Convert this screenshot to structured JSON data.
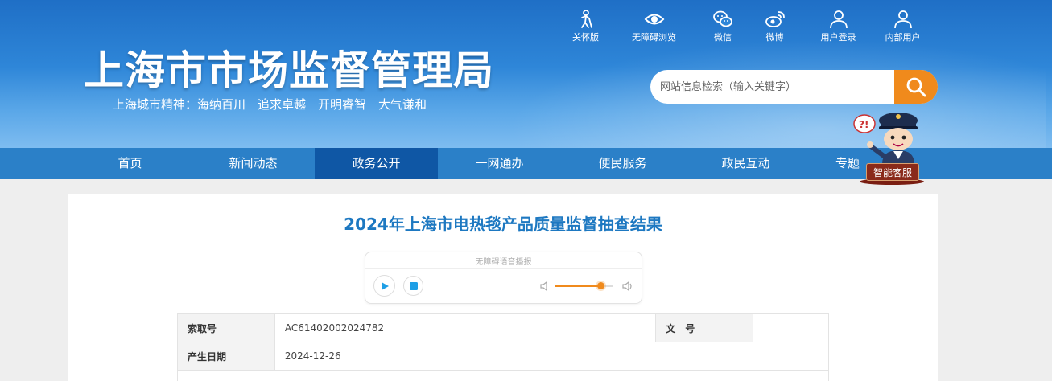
{
  "header": {
    "site_title": "上海市市场监督管理局",
    "city_spirit": "上海城市精神：海纳百川　追求卓越　开明睿智　大气谦和"
  },
  "toolbar": {
    "items": [
      {
        "label": "关怀版",
        "icon": "elder-care-icon"
      },
      {
        "label": "无障碍浏览",
        "icon": "eye-icon"
      },
      {
        "label": "微信",
        "icon": "wechat-icon"
      },
      {
        "label": "微博",
        "icon": "weibo-icon"
      },
      {
        "label": "用户登录",
        "icon": "user-icon"
      },
      {
        "label": "内部用户",
        "icon": "user-icon"
      }
    ]
  },
  "search": {
    "placeholder": "网站信息检索（输入关键字）"
  },
  "nav": {
    "items": [
      {
        "label": "首页"
      },
      {
        "label": "新闻动态"
      },
      {
        "label": "政务公开",
        "active": true
      },
      {
        "label": "一网通办"
      },
      {
        "label": "便民服务"
      },
      {
        "label": "政民互动"
      },
      {
        "label": "专题"
      }
    ]
  },
  "mascot": {
    "label": "智能客服"
  },
  "article": {
    "title": "2024年上海市电热毯产品质量监督抽查结果"
  },
  "audio": {
    "label": "无障碍语音播报",
    "volume": 0.78
  },
  "info": {
    "index_label": "索取号",
    "index_value": "AC61402002024782",
    "doc_label": "文　号",
    "doc_value": "",
    "date_label": "产生日期",
    "date_value": "2024-12-26"
  },
  "colors": {
    "header_blue": "#2e86d8",
    "nav_blue": "#2b80c8",
    "nav_active": "#0f57a5",
    "accent_orange": "#f08a1c",
    "title_blue": "#1d78c1"
  }
}
